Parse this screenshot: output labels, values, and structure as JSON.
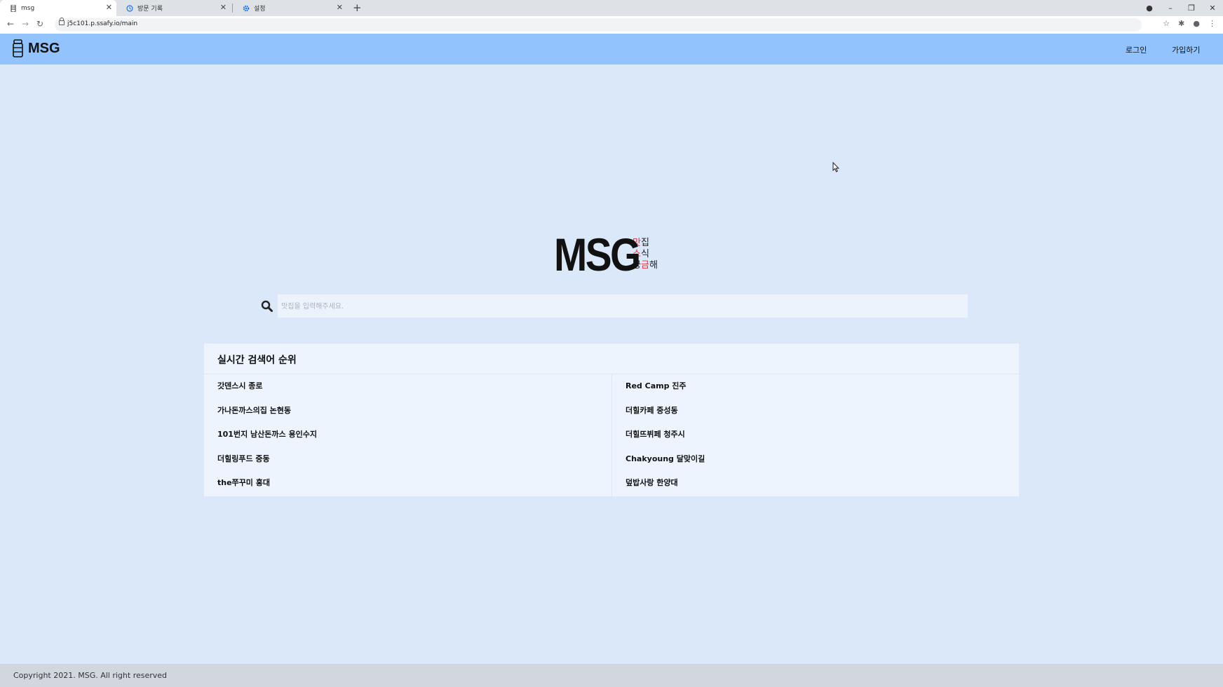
{
  "browser": {
    "tabs": [
      {
        "title": "msg",
        "icon": "app-icon"
      },
      {
        "title": "방문 기록",
        "icon": "history-icon"
      },
      {
        "title": "설정",
        "icon": "gear-icon"
      }
    ],
    "url": "j5c101.p.ssafy.io/main"
  },
  "header": {
    "logo_text": "MSG",
    "login_label": "로그인",
    "signup_label": "가입하기"
  },
  "hero": {
    "title": "MSG",
    "line1_red": "맛",
    "line1_rest": "집",
    "line2_red": "소",
    "line2_rest": "식",
    "line3_a": "궁",
    "line3_red": "금",
    "line3_b": "해"
  },
  "search": {
    "placeholder": "맛집을 입력해주세요."
  },
  "ranking": {
    "title": "실시간 검색어 순위",
    "left": [
      "갓덴스시 종로",
      "가나돈까스의집 논현동",
      "101번지 남산돈까스 용인수지",
      "더힐링푸드 중동",
      "the쭈꾸미 홍대"
    ],
    "right": [
      "Red Camp 진주",
      "더힐카페 중성동",
      "더힐뜨뷔페 청주시",
      "Chakyoung 달맞이길",
      "덮밥사랑 한양대"
    ]
  },
  "footer": {
    "copyright": "Copyright 2021. MSG. All right reserved"
  },
  "colors": {
    "page_bg": "#dbe8fa",
    "header_bg": "#93c3fd",
    "accent_red": "#e2343e"
  }
}
